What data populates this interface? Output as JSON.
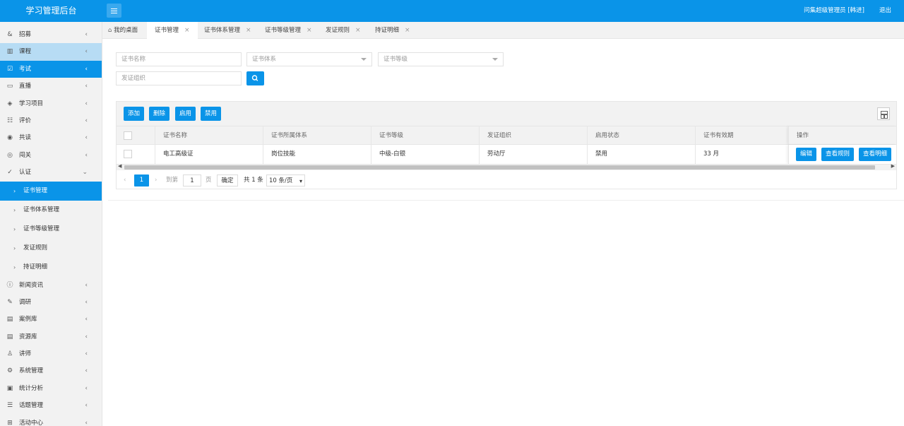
{
  "header": {
    "app_title": "学习管理后台",
    "user_label": "问集超级管理员 [韩进]",
    "logout_label": "退出"
  },
  "sidebar": {
    "items": [
      {
        "label": "招募",
        "icon": "&"
      },
      {
        "label": "课程",
        "icon": "▥"
      },
      {
        "label": "考试",
        "icon": "☑"
      },
      {
        "label": "直播",
        "icon": "▭"
      },
      {
        "label": "学习项目",
        "icon": "◈"
      },
      {
        "label": "评价",
        "icon": "☷"
      },
      {
        "label": "共读",
        "icon": "◉"
      },
      {
        "label": "闯关",
        "icon": "◎"
      },
      {
        "label": "认证",
        "icon": "✓"
      }
    ],
    "sub_items": [
      {
        "label": "证书管理"
      },
      {
        "label": "证书体系管理"
      },
      {
        "label": "证书等级管理"
      },
      {
        "label": "发证规则"
      },
      {
        "label": "持证明细"
      }
    ],
    "items_after": [
      {
        "label": "新闻资讯",
        "icon": "ⓘ"
      },
      {
        "label": "调研",
        "icon": "✎"
      },
      {
        "label": "案例库",
        "icon": "▤"
      },
      {
        "label": "资源库",
        "icon": "▤"
      },
      {
        "label": "讲师",
        "icon": "♙"
      },
      {
        "label": "系统管理",
        "icon": "⚙"
      },
      {
        "label": "统计分析",
        "icon": "▣"
      },
      {
        "label": "话题管理",
        "icon": "☰"
      },
      {
        "label": "活动中心",
        "icon": "⊞"
      }
    ]
  },
  "tabs": [
    {
      "label": "我的桌面"
    },
    {
      "label": "证书管理"
    },
    {
      "label": "证书体系管理"
    },
    {
      "label": "证书等级管理"
    },
    {
      "label": "发证规则"
    },
    {
      "label": "持证明细"
    }
  ],
  "filters": {
    "cert_name_placeholder": "证书名称",
    "cert_system_placeholder": "证书体系",
    "cert_level_placeholder": "证书等级",
    "issuer_placeholder": "发证组织"
  },
  "toolbar": {
    "add_label": "添加",
    "delete_label": "删除",
    "enable_label": "启用",
    "disable_label": "禁用"
  },
  "table": {
    "columns": [
      "证书名称",
      "证书所属体系",
      "证书等级",
      "发证组织",
      "启用状态",
      "证书有效期",
      "操作"
    ],
    "rows": [
      {
        "name": "电工高级证",
        "system": "岗位技能",
        "level": "中级-白银",
        "issuer": "劳动厅",
        "status": "禁用",
        "validity": "33 月",
        "actions": [
          "编辑",
          "查看规则",
          "查看明细"
        ]
      }
    ]
  },
  "pagination": {
    "current_page": "1",
    "goto_label": "到第",
    "goto_value": "1",
    "page_unit": "页",
    "confirm_label": "确定",
    "total_label": "共 1 条",
    "page_size": "10 条/页"
  }
}
